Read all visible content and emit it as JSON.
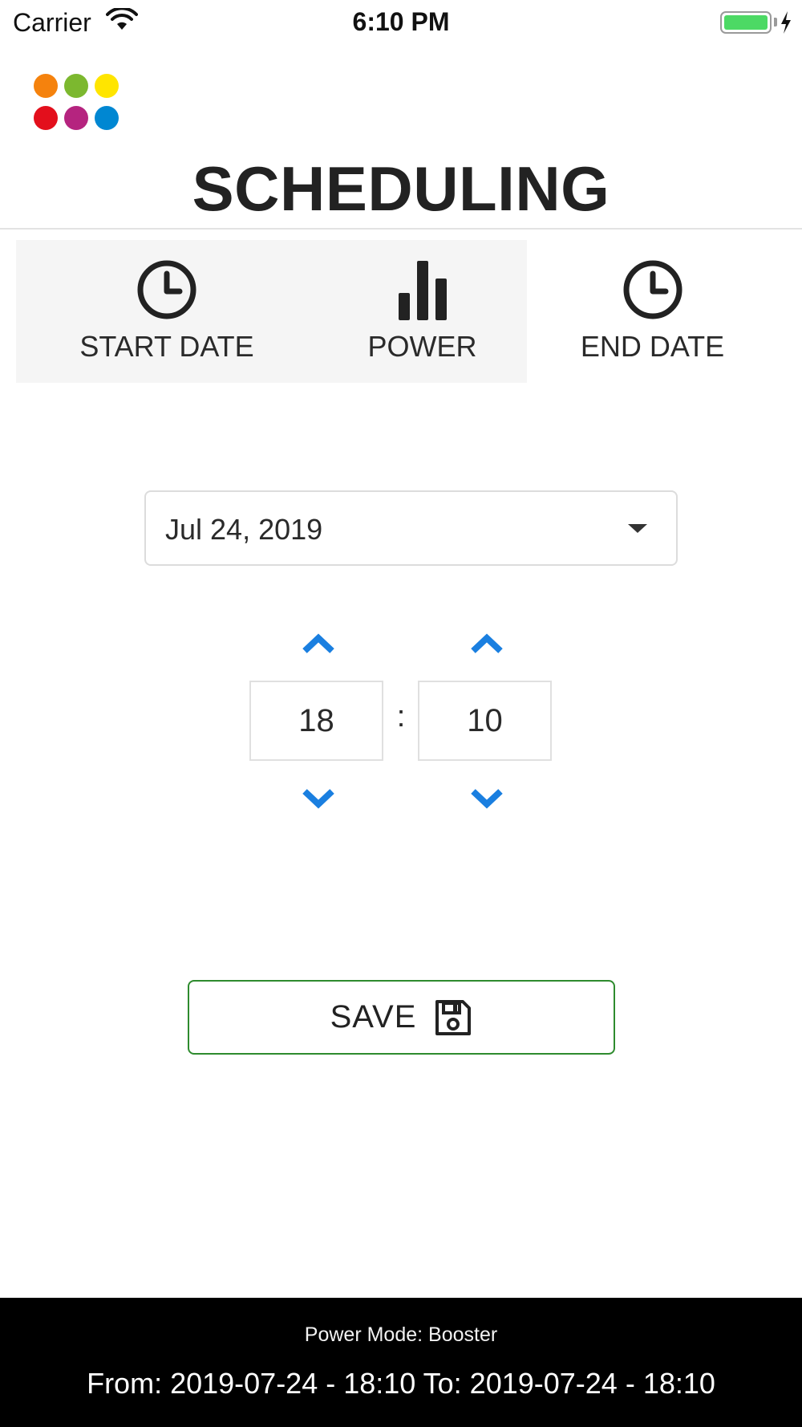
{
  "status_bar": {
    "carrier": "Carrier",
    "time": "6:10 PM",
    "battery_color": "#4cd964"
  },
  "logo": {
    "dot_colors": [
      "#f5820d",
      "#7cb82f",
      "#ffe500",
      "#e30f1c",
      "#b5247f",
      "#0087d2"
    ]
  },
  "header": {
    "title": "SCHEDULING"
  },
  "tabs": [
    {
      "label": "START DATE",
      "icon": "clock-icon"
    },
    {
      "label": "POWER",
      "icon": "bar-chart-icon"
    },
    {
      "label": "END DATE",
      "icon": "clock-icon"
    }
  ],
  "date_select": {
    "value": "Jul 24, 2019",
    "icon": "caret-down-icon"
  },
  "time_picker": {
    "hours": "18",
    "separator": ":",
    "minutes": "10",
    "accent_color": "#1a7fe0"
  },
  "save_button": {
    "label": "SAVE",
    "icon": "floppy-disk-icon",
    "border_color": "#2e8b2e"
  },
  "footer": {
    "power_mode": "Power Mode: Booster",
    "range": "From: 2019-07-24 - 18:10 To: 2019-07-24 - 18:10"
  }
}
